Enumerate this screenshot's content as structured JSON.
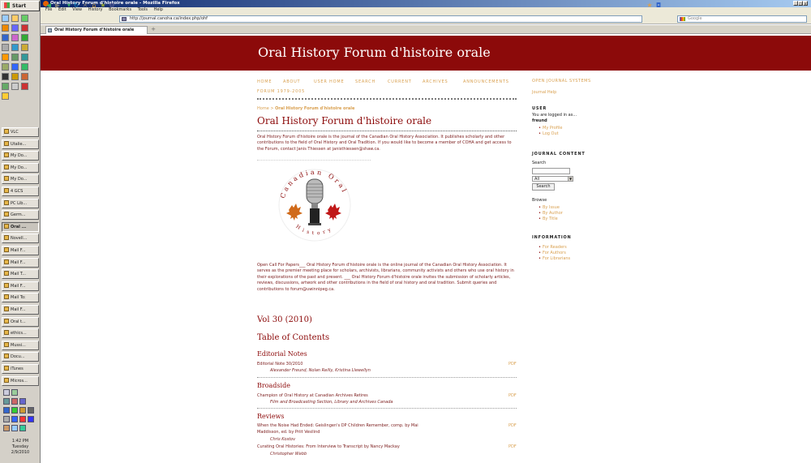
{
  "os": {
    "start_label": "Start",
    "taskbar_items": [
      {
        "label": "VLC",
        "active": false
      },
      {
        "label": "Utalie...",
        "active": false
      },
      {
        "label": "My Do...",
        "active": false
      },
      {
        "label": "My Do...",
        "active": false
      },
      {
        "label": "My Do...",
        "active": false
      },
      {
        "label": "4 GCS",
        "active": false
      },
      {
        "label": "PC Lib...",
        "active": false
      },
      {
        "label": "Germ...",
        "active": false
      },
      {
        "label": "Oral ...",
        "active": true
      },
      {
        "label": "Novell...",
        "active": false
      },
      {
        "label": "Mail F...",
        "active": false
      },
      {
        "label": "Mail F...",
        "active": false
      },
      {
        "label": "Mail T...",
        "active": false
      },
      {
        "label": "Mail F...",
        "active": false
      },
      {
        "label": "Mail To:",
        "active": false
      },
      {
        "label": "Mail F...",
        "active": false
      },
      {
        "label": "Oral t...",
        "active": false
      },
      {
        "label": "ethics...",
        "active": false
      },
      {
        "label": "Mussi...",
        "active": false
      },
      {
        "label": "Docu...",
        "active": false
      },
      {
        "label": "iTunes",
        "active": false
      },
      {
        "label": "Micros...",
        "active": false
      }
    ],
    "clock_time": "1:42 PM",
    "clock_day": "Tuesday",
    "clock_date": "2/9/2010"
  },
  "browser": {
    "window_title": "Oral History Forum d'histoire orale - Mozilla Firefox",
    "menu": [
      "File",
      "Edit",
      "View",
      "History",
      "Bookmarks",
      "Tools",
      "Help"
    ],
    "url": "http://journal.canoha.ca/index.php/ohf",
    "search_placeholder": "Google",
    "tab_title": "Oral History Forum d'histoire orale",
    "new_tab": "+"
  },
  "site": {
    "title": "Oral History Forum d'histoire orale",
    "nav": [
      "HOME",
      "ABOUT",
      "USER HOME",
      "SEARCH",
      "CURRENT",
      "ARCHIVES",
      "ANNOUNCEMENTS",
      "FORUM 1979-2005"
    ],
    "breadcrumb_home": "Home",
    "breadcrumb_sep": " > ",
    "breadcrumb_current": "Oral History Forum d'histoire orale",
    "page_title": "Oral History Forum d'histoire orale",
    "intro": "Oral History Forum d'histoire orale is the journal of the Canadian Oral History Association. It publishes scholarly and other contributions to the field of Oral History and Oral Tradition. If you would like to become a member of COHA and get access to the Forum, contact Janis Thiessen at janisthiessen@shaw.ca.",
    "logo_text_top": "Canadian Oral",
    "logo_text_bottom": "History",
    "call_for_papers": "Open Call For Papers___ Oral History Forum d'histoire orale is the online journal of the Canadian Oral History Association. It serves as the premier meeting place for scholars, archivists, librarians, community activists and others who use oral history in their explorations of the past and present. ___ Oral History Forum d'histoire orale invites the submission of scholarly articles, reviews, discussions, artwork and other contributions in the field of oral history and oral tradition. Submit queries and contributions to forum@uwinnipeg.ca.",
    "volume": "Vol 30 (2010)",
    "toc_heading": "Table of Contents",
    "sections": [
      {
        "heading": "Editorial Notes",
        "items": [
          {
            "title": "Editorial Note 30/2010",
            "authors": "Alexander Freund, Nolan Reilly, Kristina Llewellyn",
            "pdf": "PDF"
          }
        ]
      },
      {
        "heading": "Broadside",
        "items": [
          {
            "title": "Champion of Oral History at Canadian Archives Retires",
            "authors": "Film and Broadcasting Section, Library and Archives Canada",
            "pdf": "PDF"
          }
        ]
      },
      {
        "heading": "Reviews",
        "items": [
          {
            "title": "When the Noise Had Ended: Geislingen's DP Children Remember, comp. by Mai",
            "title2": "Maddisson, ed. by Priit Vesilind",
            "authors": "Chris Kostov",
            "pdf": "PDF"
          },
          {
            "title": "Curating Oral Histories: From Interview to Transcript by Nancy Mackay",
            "authors": "Christopher Webb",
            "pdf": "PDF"
          }
        ]
      }
    ]
  },
  "sidebar": {
    "ojs_link": "OPEN JOURNAL SYSTEMS",
    "journal_help": "Journal Help",
    "user_heading": "USER",
    "logged_in": "You are logged in as...",
    "username": "freund",
    "my_profile": "My Profile",
    "log_out": "Log Out",
    "content_heading": "JOURNAL CONTENT",
    "search_label": "Search",
    "search_scope": "All",
    "search_button": "Search",
    "browse_label": "Browse",
    "browse_links": [
      "By Issue",
      "By Author",
      "By Title"
    ],
    "info_heading": "INFORMATION",
    "info_links": [
      "For Readers",
      "For Authors",
      "For Librarians"
    ]
  },
  "colors": {
    "header_red": "#8c0a0a",
    "link_gold": "#d9a050",
    "text_maroon": "#7a1a1a"
  }
}
